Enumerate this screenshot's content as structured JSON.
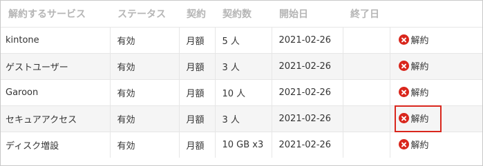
{
  "headers": {
    "service": "解約するサービス",
    "status": "ステータス",
    "contract": "契約",
    "count": "契約数",
    "start": "開始日",
    "end": "終了日",
    "action": ""
  },
  "rows": [
    {
      "service": "kintone",
      "status": "有効",
      "contract": "月額",
      "count": "5 人",
      "start": "2021-02-26",
      "end": "",
      "action": "解約",
      "highlighted": false
    },
    {
      "service": "ゲストユーザー",
      "status": "有効",
      "contract": "月額",
      "count": "3 人",
      "start": "2021-02-26",
      "end": "",
      "action": "解約",
      "highlighted": false
    },
    {
      "service": "Garoon",
      "status": "有効",
      "contract": "月額",
      "count": "10 人",
      "start": "2021-02-26",
      "end": "",
      "action": "解約",
      "highlighted": false
    },
    {
      "service": "セキュアアクセス",
      "status": "有効",
      "contract": "月額",
      "count": "3 人",
      "start": "2021-02-26",
      "end": "",
      "action": "解約",
      "highlighted": true
    },
    {
      "service": "ディスク増設",
      "status": "有効",
      "contract": "月額",
      "count": "10 GB x3",
      "start": "2021-02-26",
      "end": "",
      "action": "解約",
      "highlighted": false
    }
  ],
  "icons": {
    "cancel": "x-circle-icon"
  },
  "colors": {
    "header_text": "#b5b5b5",
    "stripe": "#f5f5f5",
    "cancel_icon": "#d9261c",
    "highlight": "#d9261c"
  }
}
